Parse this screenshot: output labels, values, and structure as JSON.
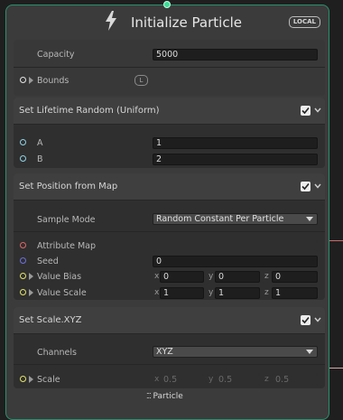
{
  "node": {
    "title": "Initialize Particle",
    "badge": "LOCAL"
  },
  "settings": {
    "capacity_label": "Capacity",
    "capacity_value": "5000",
    "bounds_label": "Bounds",
    "bounds_badge": "L"
  },
  "lifetime": {
    "title": "Set Lifetime Random (Uniform)",
    "a_label": "A",
    "a_value": "1",
    "b_label": "B",
    "b_value": "2"
  },
  "position": {
    "title": "Set Position from Map",
    "sample_mode_label": "Sample Mode",
    "sample_mode_value": "Random Constant Per Particle",
    "attribute_map_label": "Attribute Map",
    "seed_label": "Seed",
    "seed_value": "0",
    "value_bias_label": "Value Bias",
    "value_bias": {
      "x": "0",
      "y": "0",
      "z": "0"
    },
    "value_scale_label": "Value Scale",
    "value_scale": {
      "x": "1",
      "y": "1",
      "z": "1"
    },
    "axes": {
      "x": "x",
      "y": "y",
      "z": "z"
    }
  },
  "scale": {
    "title": "Set Scale.XYZ",
    "channels_label": "Channels",
    "channels_value": "XYZ",
    "scale_label": "Scale",
    "scale_values": {
      "x": "0.5",
      "y": "0.5",
      "z": "0.5"
    }
  },
  "footer": {
    "label": "Particle"
  },
  "colors": {
    "border_accent": "#2c8f6f",
    "port_cyan": "#8fd3e6",
    "port_yellow": "#e3e36a",
    "port_red": "#e06767",
    "port_blue": "#6f6fe0"
  }
}
